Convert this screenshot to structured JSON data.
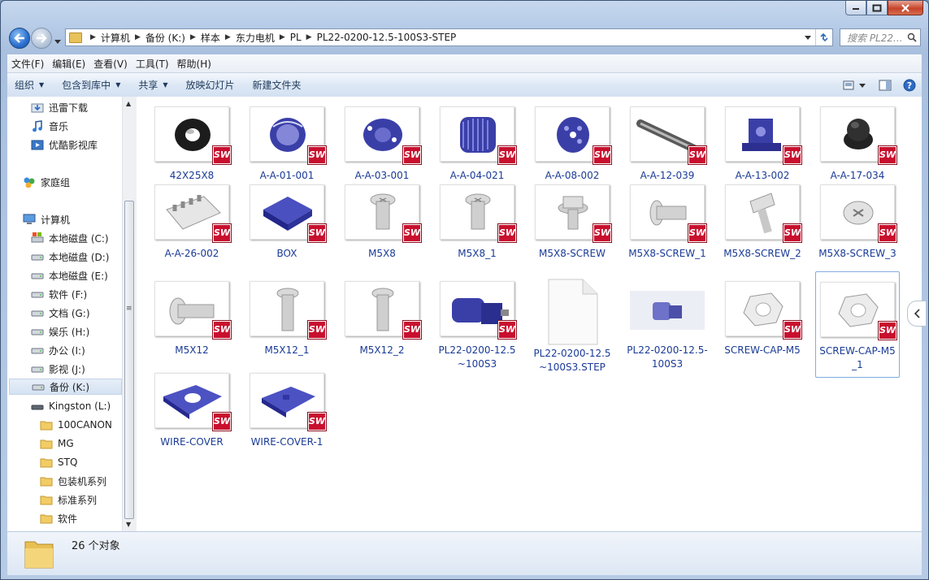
{
  "window": {
    "caption_buttons": [
      "minimize-icon",
      "maximize-icon",
      "close-icon"
    ]
  },
  "address": {
    "breadcrumbs": [
      "计算机",
      "备份 (K:)",
      "样本",
      "东力电机",
      "PL",
      "PL22-0200-12.5-100S3-STEP"
    ],
    "search_placeholder": "搜索 PL22..."
  },
  "menu": [
    "文件(F)",
    "编辑(E)",
    "查看(V)",
    "工具(T)",
    "帮助(H)"
  ],
  "commands": {
    "organize": "组织",
    "include_library": "包含到库中",
    "share": "共享",
    "slideshow": "放映幻灯片",
    "new_folder": "新建文件夹"
  },
  "nav": {
    "items": [
      {
        "label": "迅雷下载",
        "icon": "download-folder-icon"
      },
      {
        "label": "音乐",
        "icon": "music-icon"
      },
      {
        "label": "优酷影视库",
        "icon": "video-library-icon"
      },
      {
        "label": "家庭组",
        "icon": "homegroup-icon"
      },
      {
        "label": "计算机",
        "icon": "computer-icon"
      },
      {
        "label": "本地磁盘 (C:)",
        "icon": "system-drive-icon"
      },
      {
        "label": "本地磁盘 (D:)",
        "icon": "drive-icon"
      },
      {
        "label": "本地磁盘 (E:)",
        "icon": "drive-icon"
      },
      {
        "label": "软件 (F:)",
        "icon": "drive-icon"
      },
      {
        "label": "文档 (G:)",
        "icon": "drive-icon"
      },
      {
        "label": "娱乐 (H:)",
        "icon": "drive-icon"
      },
      {
        "label": "办公 (I:)",
        "icon": "drive-icon"
      },
      {
        "label": "影视 (J:)",
        "icon": "drive-icon"
      },
      {
        "label": "备份 (K:)",
        "icon": "drive-icon"
      },
      {
        "label": "Kingston (L:)",
        "icon": "usb-drive-icon"
      },
      {
        "label": "100CANON",
        "icon": "folder-icon"
      },
      {
        "label": "MG",
        "icon": "folder-icon"
      },
      {
        "label": "STQ",
        "icon": "folder-icon"
      },
      {
        "label": "包装机系列",
        "icon": "folder-icon"
      },
      {
        "label": "标准系列",
        "icon": "folder-icon"
      },
      {
        "label": "软件",
        "icon": "folder-icon"
      }
    ],
    "selected": "备份 (K:)"
  },
  "files": [
    {
      "name": "42X25X8",
      "thumb": "ring-black",
      "sw": true
    },
    {
      "name": "A-A-01-001",
      "thumb": "drum-blue",
      "sw": true
    },
    {
      "name": "A-A-03-001",
      "thumb": "flange-blue",
      "sw": true
    },
    {
      "name": "A-A-04-021",
      "thumb": "motor-housing-blue",
      "sw": true
    },
    {
      "name": "A-A-08-002",
      "thumb": "disc-blue",
      "sw": true
    },
    {
      "name": "A-A-12-039",
      "thumb": "shaft-grey",
      "sw": true
    },
    {
      "name": "A-A-13-002",
      "thumb": "bracket-blue",
      "sw": true
    },
    {
      "name": "A-A-17-034",
      "thumb": "knob-black",
      "sw": true
    },
    {
      "name": "A-A-26-002",
      "thumb": "terminal-block",
      "sw": true
    },
    {
      "name": "BOX",
      "thumb": "box-blue",
      "sw": true
    },
    {
      "name": "M5X8",
      "thumb": "screw-short",
      "sw": true
    },
    {
      "name": "M5X8_1",
      "thumb": "screw-short",
      "sw": true
    },
    {
      "name": "M5X8-SCREW",
      "thumb": "screw-washer",
      "sw": true
    },
    {
      "name": "M5X8-SCREW_1",
      "thumb": "screw-side",
      "sw": true
    },
    {
      "name": "M5X8-SCREW_2",
      "thumb": "screw-tilt",
      "sw": true
    },
    {
      "name": "M5X8-SCREW_3",
      "thumb": "screw-head",
      "sw": true
    },
    {
      "name": "M5X12",
      "thumb": "screw-long-side",
      "sw": true
    },
    {
      "name": "M5X12_1",
      "thumb": "screw-long",
      "sw": true
    },
    {
      "name": "M5X12_2",
      "thumb": "screw-long",
      "sw": true
    },
    {
      "name": "PL22-0200-12.5~100S3",
      "thumb": "gearmotor-blue",
      "sw": true
    },
    {
      "name": "PL22-0200-12.5~100S3.STEP",
      "thumb": "blank-document",
      "sw": false
    },
    {
      "name": "PL22-0200-12.5-100S3",
      "thumb": "gearmotor-photo",
      "sw": false
    },
    {
      "name": "SCREW-CAP-M5",
      "thumb": "nut",
      "sw": true
    },
    {
      "name": "SCREW-CAP-M5_1",
      "thumb": "nut",
      "sw": true
    },
    {
      "name": "WIRE-COVER",
      "thumb": "cover-blue",
      "sw": true
    },
    {
      "name": "WIRE-COVER-1",
      "thumb": "cover-blue-2",
      "sw": true
    }
  ],
  "sw_badge": "SW",
  "selected_file": "SCREW-CAP-M5_1",
  "status": {
    "count_text": "26 个对象"
  },
  "colors": {
    "file_name": "#1a3b96",
    "sw_badge": "#c8102e",
    "part_blue": "#3a3fa8"
  }
}
